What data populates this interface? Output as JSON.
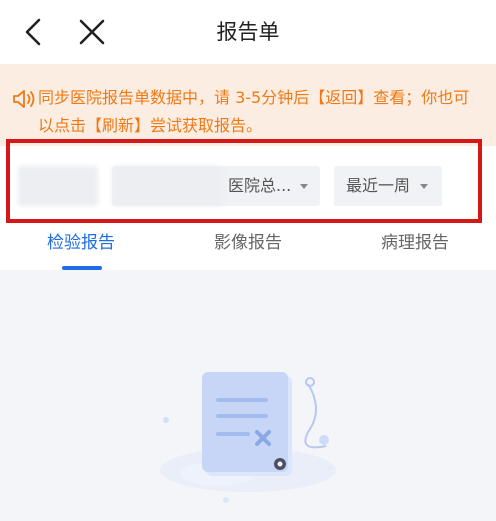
{
  "header": {
    "title": "报告单",
    "back_icon": "chevron-left-icon",
    "close_icon": "close-icon"
  },
  "notice": {
    "icon": "speaker-icon",
    "text": "同步医院报告单数据中，请 3-5分钟后【返回】查看；你也可以点击【刷新】尝试获取报告。",
    "color": "#ee7a15",
    "background": "#fcede3"
  },
  "filters": {
    "hospital_label": "医院总...",
    "time_range_label": "最近一周"
  },
  "tabs": [
    {
      "label": "检验报告",
      "active": true
    },
    {
      "label": "影像报告",
      "active": false
    },
    {
      "label": "病理报告",
      "active": false
    }
  ],
  "colors": {
    "accent": "#1e6ce6",
    "highlight_border": "#d61717",
    "page_background": "#f4f5f9"
  },
  "empty_state": {
    "icon": "empty-document-illustration"
  }
}
